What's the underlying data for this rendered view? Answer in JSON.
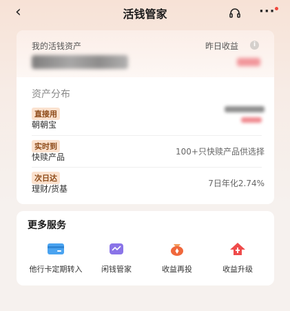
{
  "nav": {
    "back_icon": "back-arrow-icon",
    "title": "活钱管家",
    "headset_icon": "headset-icon",
    "more_icon": "more-dots-icon",
    "notification_dot_color": "#f0463c"
  },
  "assets": {
    "my_assets_label": "我的活钱资产",
    "yesterday_income_label": "昨日收益",
    "info_icon": "info-icon",
    "amount_blurred": true,
    "income_blurred": true
  },
  "distribution": {
    "title": "资产分布",
    "rows": [
      {
        "tag": "直接用",
        "name": "朝朝宝",
        "right": "",
        "right_blurred": true
      },
      {
        "tag": "实时到",
        "name": "快赎产品",
        "right": "100+只快赎产品供选择",
        "right_blurred": false
      },
      {
        "tag": "次日达",
        "name": "理财/货基",
        "right": "7日年化2.74%",
        "right_blurred": false
      }
    ]
  },
  "services": {
    "title": "更多服务",
    "items": [
      {
        "label": "他行卡定期转入",
        "icon": "bank-card-icon",
        "color": "#4aa3f0"
      },
      {
        "label": "闲钱管家",
        "icon": "wallet-chart-icon",
        "color": "#8a74e8"
      },
      {
        "label": "收益再投",
        "icon": "money-bag-icon",
        "color": "#f0683c"
      },
      {
        "label": "收益升级",
        "icon": "upgrade-icon",
        "color": "#ef4b4b"
      }
    ]
  }
}
